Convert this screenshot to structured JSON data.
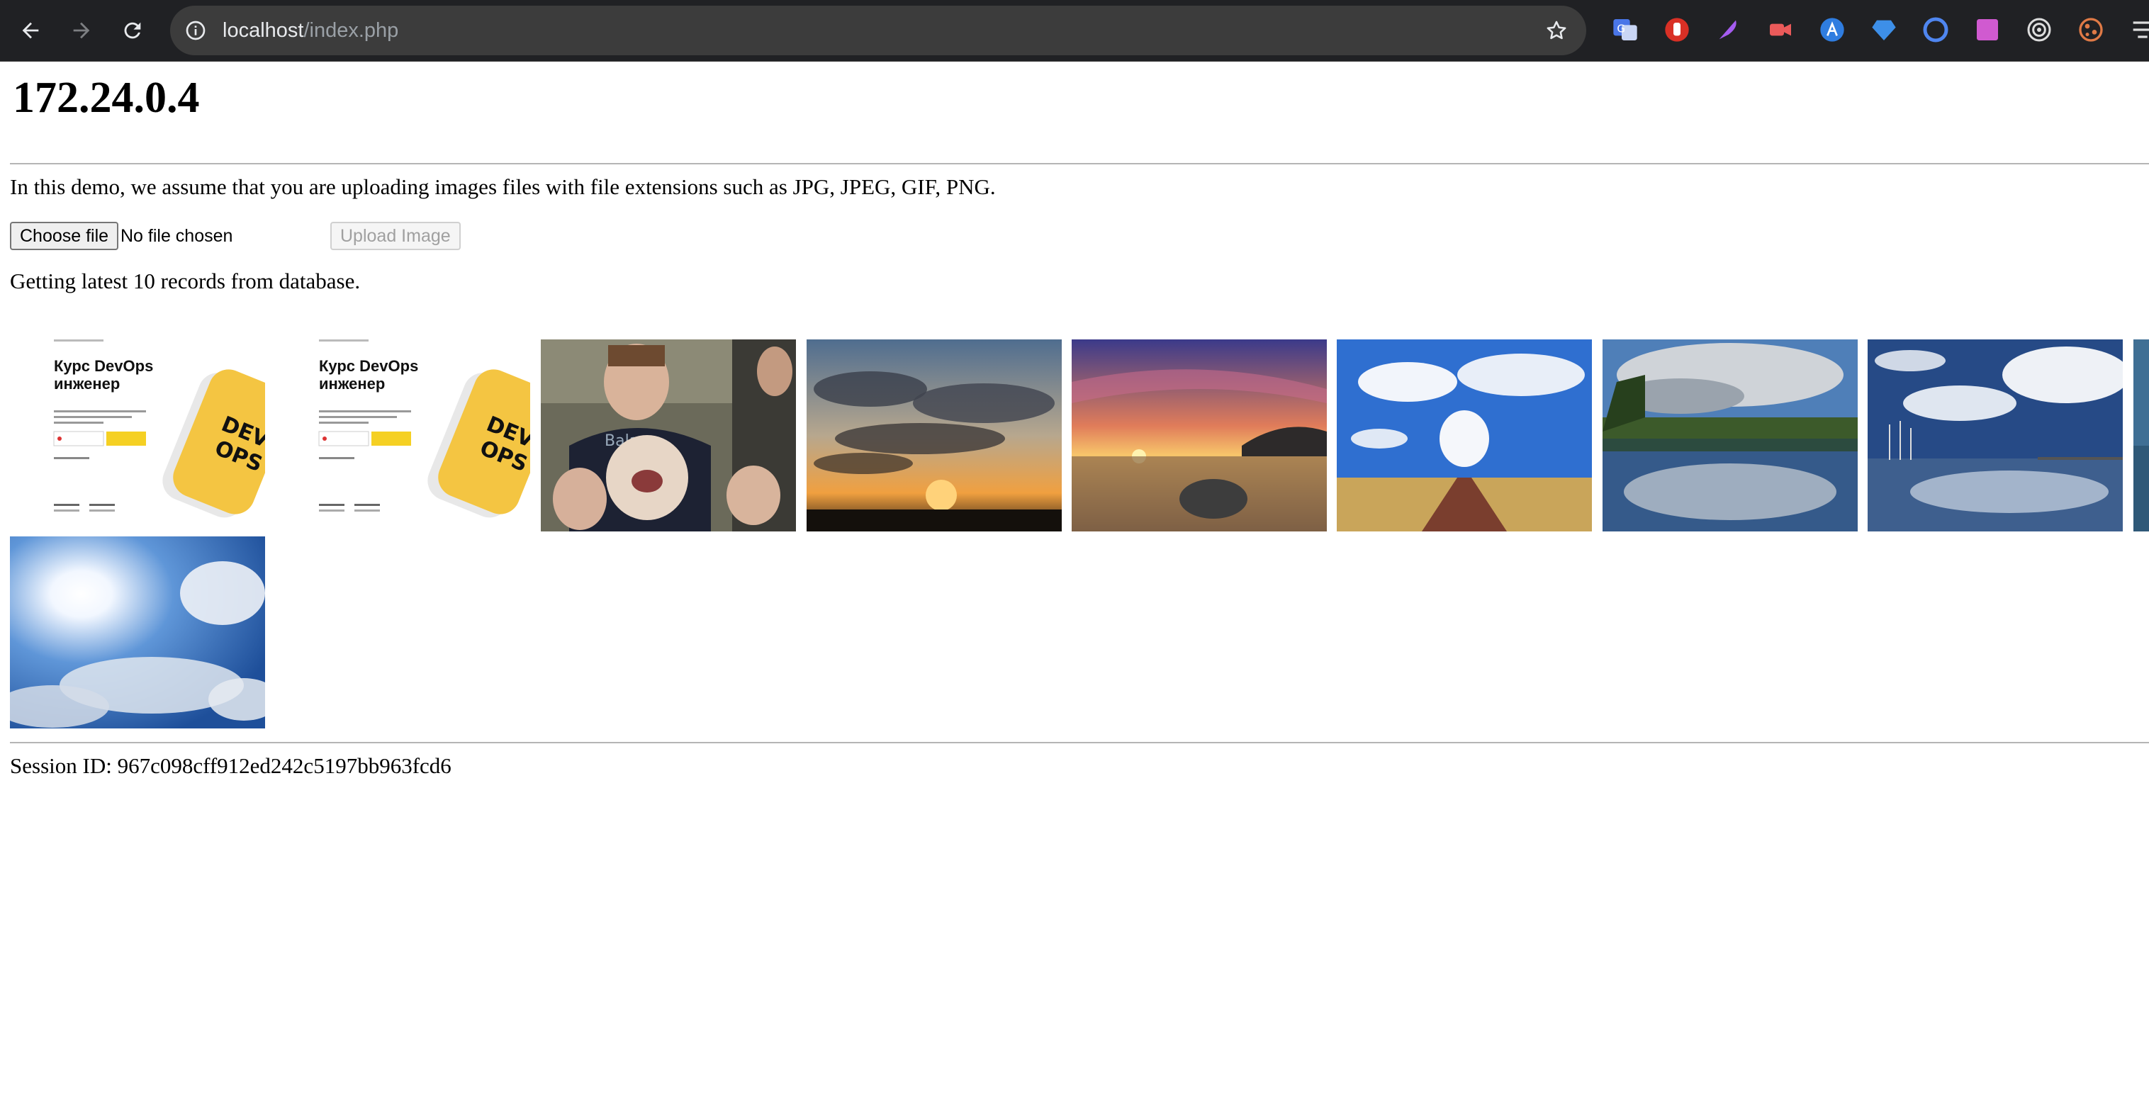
{
  "browser": {
    "url_host": "localhost",
    "url_path": "/index.php",
    "nav": [
      "back-icon",
      "forward-icon",
      "reload-icon"
    ],
    "extensions": [
      {
        "name": "google-translate-icon",
        "color": "#4a76e8"
      },
      {
        "name": "adblock-hand-icon",
        "color": "#d93025"
      },
      {
        "name": "quill-feather-icon",
        "color": "#a55cf0"
      },
      {
        "name": "video-camera-icon",
        "color": "#ea5a5a"
      },
      {
        "name": "app-store-icon",
        "color": "#2f7de0"
      },
      {
        "name": "diamond-icon",
        "color": "#3d8fe8"
      },
      {
        "name": "ring-circle-icon",
        "color": "#4f86f0"
      },
      {
        "name": "gradient-square-icon",
        "color": "#d05ad0"
      },
      {
        "name": "target-icon",
        "color": "#dddddd"
      },
      {
        "name": "cookie-icon",
        "color": "#e07a46"
      },
      {
        "name": "extensions-cut-icon",
        "color": "#dddddd"
      }
    ]
  },
  "page": {
    "title": "172.24.0.4",
    "intro": "In this demo, we assume that you are uploading images files with file extensions such as JPG, JPEG, GIF, PNG.",
    "choose_file_label": "Choose file",
    "file_status": "No file chosen",
    "upload_label": "Upload Image",
    "records_text": "Getting latest 10 records from database.",
    "session": "Session ID: 967c098cff912ed242c5197bb963fcd6"
  },
  "gallery": [
    {
      "name": "devops-course-image",
      "alt_title": "Курс DevOps инженер",
      "badge": "DEV OPS"
    },
    {
      "name": "devops-course-image",
      "alt_title": "Курс DevOps инженер",
      "badge": "DEV OPS"
    },
    {
      "name": "family-photo-image"
    },
    {
      "name": "sunset-clouds-image"
    },
    {
      "name": "beach-sunset-image"
    },
    {
      "name": "road-sky-image"
    },
    {
      "name": "lake-reflection-image"
    },
    {
      "name": "harbor-clouds-image"
    },
    {
      "name": "partial-image"
    },
    {
      "name": "sun-sky-image"
    }
  ]
}
